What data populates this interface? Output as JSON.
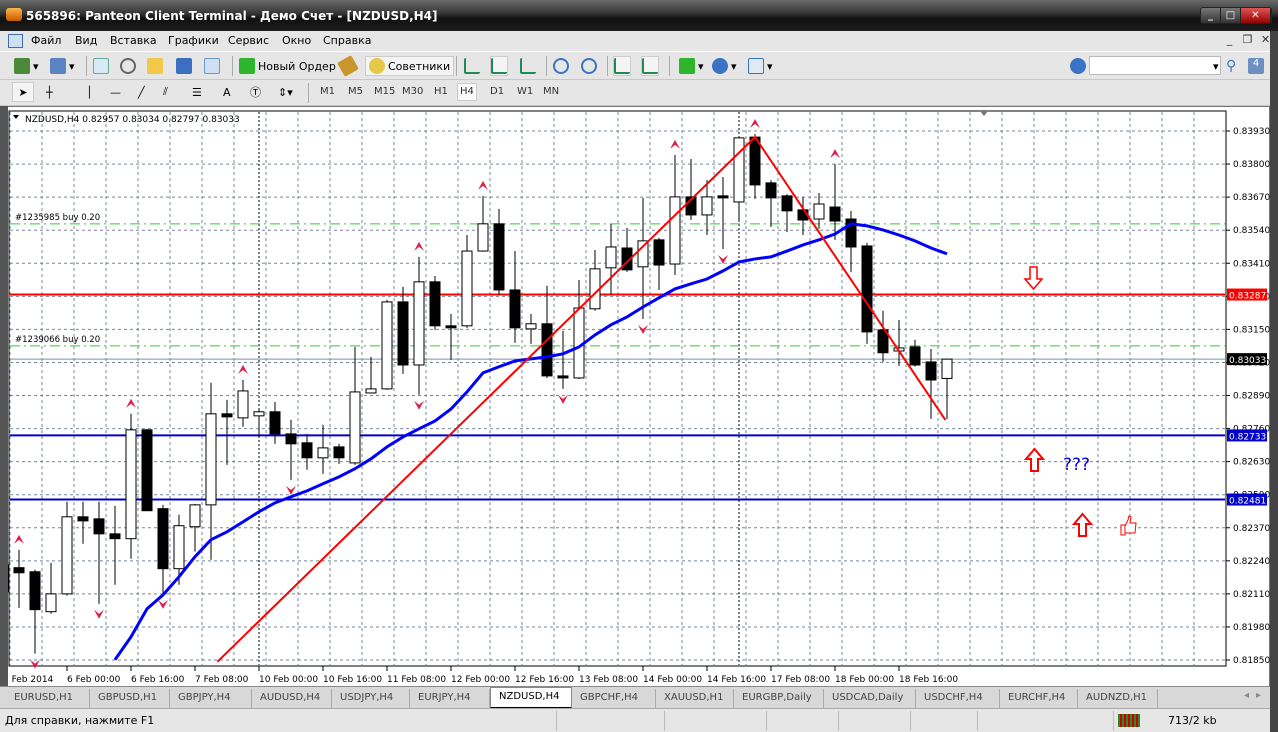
{
  "window": {
    "title": "565896: Panteon Client Terminal - Демо Счет - [NZDUSD,H4]"
  },
  "menu": [
    "Файл",
    "Вид",
    "Вставка",
    "Графики",
    "Сервис",
    "Окно",
    "Справка"
  ],
  "toolbar": {
    "new_order": "Новый Ордер",
    "advisors": "Советники",
    "search_placeholder": ""
  },
  "timeframes": [
    "M1",
    "M5",
    "M15",
    "M30",
    "H1",
    "H4",
    "D1",
    "W1",
    "MN"
  ],
  "active_timeframe": "H4",
  "chart": {
    "header": "NZDUSD,H4  0.82957 0.83034 0.82797 0.83033",
    "orders": [
      {
        "label": "#1235985 buy 0.20",
        "price": 0.83565
      },
      {
        "label": "#1239066 buy 0.20",
        "price": 0.83085
      }
    ],
    "hlines": [
      {
        "price": 0.83287,
        "label": "0.83287",
        "color": "#ff0000"
      },
      {
        "price": 0.82733,
        "label": "0.82733",
        "color": "#0000cc"
      },
      {
        "price": 0.82481,
        "label": "0.82481",
        "color": "#0000cc"
      }
    ],
    "current_price": {
      "price": 0.83033,
      "label": "0.83033"
    },
    "price_ticks": [
      "0.83930",
      "0.83800",
      "0.83670",
      "0.83540",
      "0.83410",
      "0.83280",
      "0.83150",
      "0.83020",
      "0.82890",
      "0.82760",
      "0.82630",
      "0.82500",
      "0.82370",
      "0.82240",
      "0.82110",
      "0.81980",
      "0.81850"
    ],
    "price_range": [
      0.8185,
      0.8393
    ],
    "time_labels": [
      "5 Feb 2014",
      "6 Feb 00:00",
      "6 Feb 16:00",
      "7 Feb 08:00",
      "10 Feb 00:00",
      "10 Feb 16:00",
      "11 Feb 08:00",
      "12 Feb 00:00",
      "12 Feb 16:00",
      "13 Feb 08:00",
      "14 Feb 00:00",
      "14 Feb 16:00",
      "17 Feb 08:00",
      "18 Feb 00:00",
      "18 Feb 16:00"
    ],
    "week_separators": [
      16,
      46
    ],
    "ohlc": [
      [
        0.82118,
        0.82236,
        0.81941,
        0.82224
      ],
      [
        0.82213,
        0.82283,
        0.82055,
        0.82193
      ],
      [
        0.82197,
        0.82205,
        0.81875,
        0.82048
      ],
      [
        0.8204,
        0.82232,
        0.82032,
        0.8211
      ],
      [
        0.8211,
        0.82472,
        0.82103,
        0.82413
      ],
      [
        0.82413,
        0.82472,
        0.82307,
        0.82397
      ],
      [
        0.82405,
        0.82472,
        0.82071,
        0.82346
      ],
      [
        0.82346,
        0.82456,
        0.82146,
        0.82327
      ],
      [
        0.82327,
        0.82818,
        0.82248,
        0.82755
      ],
      [
        0.82755,
        0.82759,
        0.82437,
        0.82437
      ],
      [
        0.82445,
        0.8246,
        0.8211,
        0.82209
      ],
      [
        0.82209,
        0.82421,
        0.82146,
        0.82378
      ],
      [
        0.82374,
        0.82464,
        0.82276,
        0.8246
      ],
      [
        0.8246,
        0.8294,
        0.82244,
        0.82818
      ],
      [
        0.82818,
        0.82873,
        0.82617,
        0.82806
      ],
      [
        0.82802,
        0.82951,
        0.82767,
        0.82908
      ],
      [
        0.8281,
        0.82834,
        0.82727,
        0.82826
      ],
      [
        0.82826,
        0.82865,
        0.827,
        0.82739
      ],
      [
        0.82739,
        0.82794,
        0.82558,
        0.827
      ],
      [
        0.82704,
        0.82739,
        0.82598,
        0.82645
      ],
      [
        0.82645,
        0.82775,
        0.82582,
        0.82684
      ],
      [
        0.82688,
        0.827,
        0.82621,
        0.82645
      ],
      [
        0.82625,
        0.83081,
        0.82617,
        0.82904
      ],
      [
        0.829,
        0.83042,
        0.829,
        0.82916
      ],
      [
        0.82916,
        0.83266,
        0.82912,
        0.83258
      ],
      [
        0.83258,
        0.83317,
        0.82975,
        0.8301
      ],
      [
        0.8301,
        0.83435,
        0.82893,
        0.83337
      ],
      [
        0.83337,
        0.8336,
        0.83148,
        0.83164
      ],
      [
        0.83164,
        0.83211,
        0.8303,
        0.83156
      ],
      [
        0.83164,
        0.83521,
        0.83156,
        0.83458
      ],
      [
        0.83458,
        0.83675,
        0.83455,
        0.83565
      ],
      [
        0.83565,
        0.83624,
        0.83286,
        0.83305
      ],
      [
        0.83305,
        0.83458,
        0.83097,
        0.83156
      ],
      [
        0.83152,
        0.83211,
        0.83093,
        0.83172
      ],
      [
        0.83172,
        0.83321,
        0.82959,
        0.82967
      ],
      [
        0.82967,
        0.83144,
        0.82916,
        0.82959
      ],
      [
        0.82959,
        0.83344,
        0.82955,
        0.83234
      ],
      [
        0.83231,
        0.83462,
        0.83223,
        0.83388
      ],
      [
        0.83392,
        0.83565,
        0.83286,
        0.83474
      ],
      [
        0.8347,
        0.83549,
        0.83376,
        0.83384
      ],
      [
        0.83396,
        0.83667,
        0.83191,
        0.83498
      ],
      [
        0.83502,
        0.8351,
        0.83305,
        0.83403
      ],
      [
        0.83407,
        0.83836,
        0.83364,
        0.83671
      ],
      [
        0.83671,
        0.8382,
        0.8358,
        0.836
      ],
      [
        0.836,
        0.83737,
        0.83521,
        0.83671
      ],
      [
        0.83675,
        0.83749,
        0.83466,
        0.83667
      ],
      [
        0.83651,
        0.8391,
        0.83572,
        0.83903
      ],
      [
        0.83906,
        0.83918,
        0.83663,
        0.83718
      ],
      [
        0.83726,
        0.83737,
        0.83553,
        0.83667
      ],
      [
        0.83675,
        0.83682,
        0.83533,
        0.83616
      ],
      [
        0.8362,
        0.83671,
        0.83521,
        0.8358
      ],
      [
        0.83584,
        0.83686,
        0.83545,
        0.83643
      ],
      [
        0.83631,
        0.838,
        0.83502,
        0.83576
      ],
      [
        0.83584,
        0.83616,
        0.83376,
        0.83474
      ],
      [
        0.83478,
        0.8349,
        0.83093,
        0.8314
      ],
      [
        0.83148,
        0.83223,
        0.83022,
        0.83058
      ],
      [
        0.83065,
        0.83187,
        0.83006,
        0.83077
      ],
      [
        0.83081,
        0.83109,
        0.83003,
        0.8301
      ],
      [
        0.83022,
        0.83073,
        0.82798,
        0.82951
      ],
      [
        0.82957,
        0.83034,
        0.82797,
        0.83033
      ]
    ],
    "ma_start_bar": 7,
    "ma": [
      0.81851,
      0.81941,
      0.82051,
      0.82106,
      0.82177,
      0.82256,
      0.82323,
      0.82354,
      0.82393,
      0.82433,
      0.82468,
      0.82492,
      0.82515,
      0.82543,
      0.8257,
      0.82602,
      0.82641,
      0.82688,
      0.82727,
      0.82759,
      0.8279,
      0.82837,
      0.82904,
      0.82979,
      0.83003,
      0.83026,
      0.83034,
      0.83042,
      0.83054,
      0.83081,
      0.83128,
      0.83168,
      0.83199,
      0.83238,
      0.83274,
      0.83309,
      0.83329,
      0.83348,
      0.8338,
      0.83415,
      0.83427,
      0.83435,
      0.83458,
      0.83482,
      0.83502,
      0.83525,
      0.83565,
      0.83557,
      0.83541,
      0.83521,
      0.83498,
      0.8347,
      0.83447
    ],
    "ma_color": "#0000ff",
    "trendline": [
      {
        "bar": 13.4,
        "price": 0.81843
      },
      {
        "bar": 47.0,
        "price": 0.83906
      },
      {
        "bar": 58.9,
        "price": 0.82794
      }
    ],
    "fractals_up": [
      1,
      8,
      15,
      26,
      30,
      42,
      47,
      52
    ],
    "fractals_down": [
      2,
      6,
      10,
      18,
      26,
      35,
      40,
      45
    ],
    "annotations": {
      "question": "???"
    }
  },
  "tabs": [
    "EURUSD,H1",
    "GBPUSD,H1",
    "GBPJPY,H4",
    "AUDUSD,H4",
    "USDJPY,H4",
    "EURJPY,H4",
    "NZDUSD,H4",
    "GBPCHF,H4",
    "XAUUSD,H1",
    "EURGBP,Daily",
    "USDCAD,Daily",
    "USDCHF,H4",
    "EURCHF,H4",
    "AUDNZD,H1"
  ],
  "active_tab": 6,
  "status": {
    "help": "Для справки, нажмите F1",
    "traffic": "713/2 kb"
  }
}
